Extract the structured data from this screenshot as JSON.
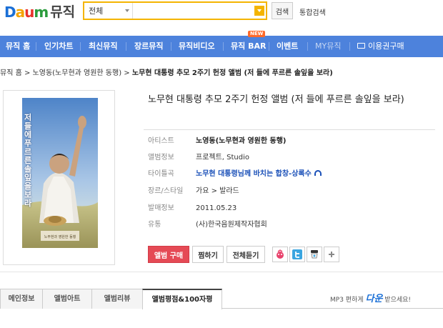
{
  "logo": {
    "d": "D",
    "a": "a",
    "u": "u",
    "m": "m",
    "service": "뮤직"
  },
  "search": {
    "category": "전체",
    "value": "",
    "button_label": "검색",
    "total_label": "통합검색"
  },
  "nav": {
    "items": [
      {
        "label": "뮤직 홈"
      },
      {
        "label": "인기차트"
      },
      {
        "label": "최신뮤직"
      },
      {
        "label": "장르뮤직"
      },
      {
        "label": "뮤직비디오"
      },
      {
        "label": "뮤직 BAR",
        "badge": "NEW"
      },
      {
        "label": "이벤트"
      },
      {
        "label": "MY뮤직"
      },
      {
        "label": "이용권구매"
      }
    ]
  },
  "breadcrumb": {
    "items": [
      "뮤직 홈",
      "노영동(노무현과 영원한 동행)"
    ],
    "separator": ">",
    "current": "노무현 대통령 추모 2주기 헌정 앨범 (저 들에 푸르른 솔잎을 보라)"
  },
  "album": {
    "title": "노무현 대통령 추모 2주기 헌정 앨범 (저 들에 푸르른 솔잎을 보라)",
    "cover_text": "저 들에 푸르른 솔잎을 보라",
    "info": [
      {
        "label": "아티스트",
        "value": "노영동(노무현과 영원한 동행)",
        "style": "bold"
      },
      {
        "label": "앨범정보",
        "value": "프로젝트, Studio",
        "style": "normal"
      },
      {
        "label": "타이틀곡",
        "value": "노무현 대통령님께 바치는 합창-상록수",
        "style": "link"
      },
      {
        "label": "장르/스타일",
        "value": "가요 > 발라드",
        "style": "normal"
      },
      {
        "label": "발매정보",
        "value": "2011.05.23",
        "style": "normal"
      },
      {
        "label": "유통",
        "value": "(사)한국음원제작자협회",
        "style": "normal"
      }
    ]
  },
  "actions": {
    "buy_label": "앨범 구매",
    "like_label": "찜하기",
    "play_all_label": "전체듣기"
  },
  "tabs": [
    {
      "label": "메인정보",
      "active": false
    },
    {
      "label": "앨범아트",
      "active": false
    },
    {
      "label": "앨범리뷰",
      "active": false
    },
    {
      "label": "앨범평점&100자평",
      "active": true
    }
  ],
  "mp3_note": {
    "prefix": "MP3 편하게",
    "brand": "다운",
    "suffix": "받으세요!"
  },
  "colors": {
    "nav_bg": "#4d82dc",
    "search_border": "#f4b400",
    "buy_button": "#e54a55",
    "link": "#1a50b8"
  }
}
